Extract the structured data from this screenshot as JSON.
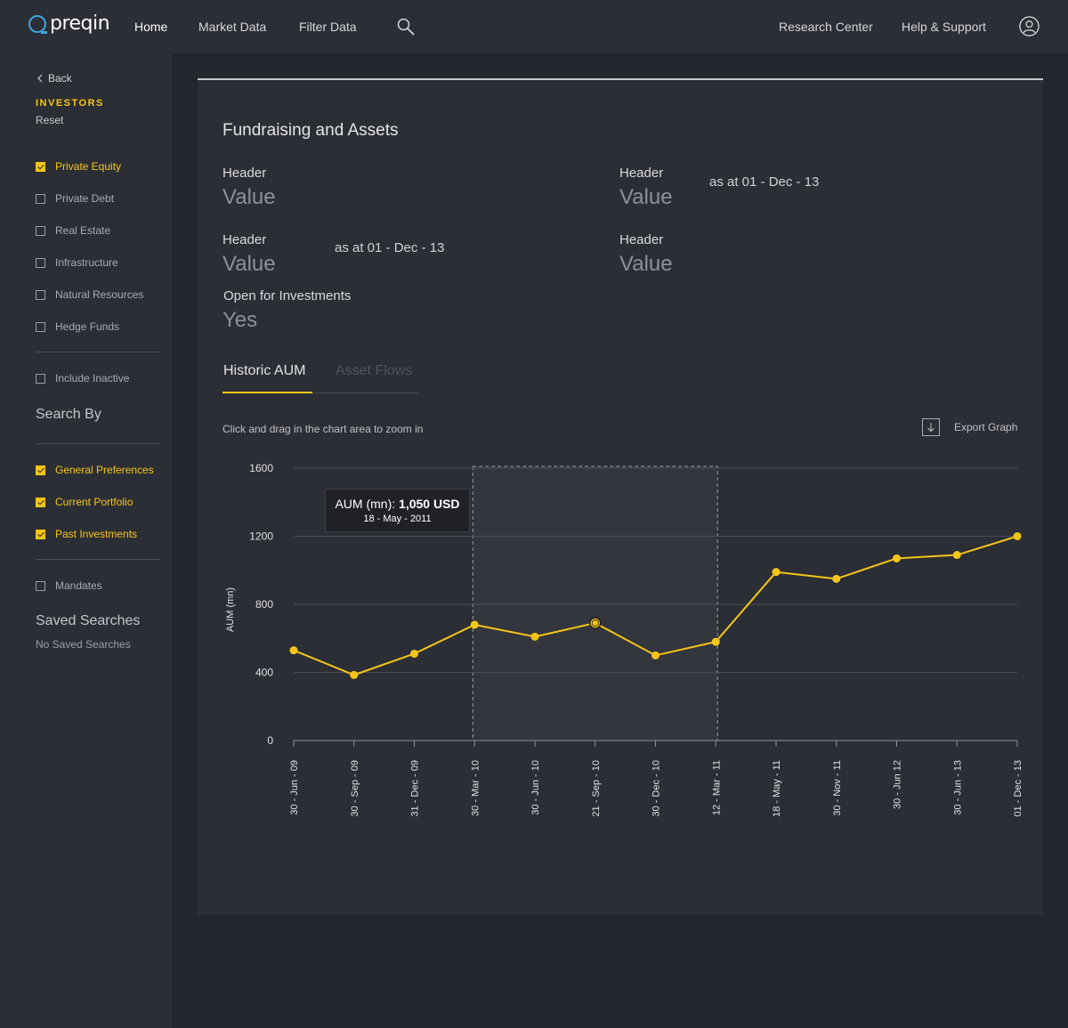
{
  "brand": {
    "name": "preqin",
    "accent": "#3aa7e0"
  },
  "nav": {
    "home": "Home",
    "market_data": "Market Data",
    "filter_data": "Filter Data",
    "research_center": "Research Center",
    "help_support": "Help & Support"
  },
  "sidebar": {
    "back": "Back",
    "section": "INVESTORS",
    "reset": "Reset",
    "asset_classes": [
      {
        "label": "Private Equity",
        "checked": true
      },
      {
        "label": "Private Debt",
        "checked": false
      },
      {
        "label": "Real Estate",
        "checked": false
      },
      {
        "label": "Infrastructure",
        "checked": false
      },
      {
        "label": "Natural Resources",
        "checked": false
      },
      {
        "label": "Hedge Funds",
        "checked": false
      }
    ],
    "include_inactive": {
      "label": "Include Inactive",
      "checked": false
    },
    "search_by_heading": "Search By",
    "search_by": [
      {
        "label": "General Preferences",
        "checked": true
      },
      {
        "label": "Current Portfolio",
        "checked": true
      },
      {
        "label": "Past Investments",
        "checked": true
      }
    ],
    "mandates": {
      "label": "Mandates",
      "checked": false
    },
    "saved_searches_heading": "Saved Searches",
    "saved_searches_empty": "No Saved Searches"
  },
  "main": {
    "title": "Fundraising and Assets",
    "fields": [
      {
        "header": "Header",
        "value": "Value",
        "note": ""
      },
      {
        "header": "Header",
        "value": "Value",
        "note": "as at 01 - Dec - 13"
      },
      {
        "header": "Header",
        "value": "Value",
        "note": "as at 01 - Dec - 13"
      },
      {
        "header": "Header",
        "value": "Value",
        "note": ""
      }
    ],
    "open_for_investments": {
      "header": "Open for Investments",
      "value": "Yes"
    },
    "tabs": [
      {
        "label": "Historic AUM",
        "active": true
      },
      {
        "label": "Asset Flows",
        "active": false
      }
    ],
    "hint": "Click and drag in the chart area to zoom in",
    "export_label": "Export Graph",
    "tooltip": {
      "prefix": "AUM (mn):",
      "value": "1,050 USD",
      "date": "18 - May - 2011"
    }
  },
  "colors": {
    "accent": "#f5c518",
    "background": "#23262d",
    "panel": "#2b2e35"
  },
  "chart_data": {
    "type": "line",
    "ylabel": "AUM (mn)",
    "xlabel": "",
    "ylim": [
      0,
      1600
    ],
    "yticks": [
      0,
      400,
      800,
      1200,
      1600
    ],
    "grid": true,
    "categories": [
      "30 - Jun - 09",
      "30 - Sep - 09",
      "31 - Dec - 09",
      "30 - Mar - 10",
      "30 - Jun - 10",
      "21 - Sep - 10",
      "30 - Dec - 10",
      "12 - Mar - 11",
      "18 - May - 11",
      "30 - Nov - 11",
      "30 - Jun 12",
      "30 - Jun - 13",
      "01 - Dec - 13"
    ],
    "series": [
      {
        "values": [
          530,
          385,
          510,
          680,
          610,
          690,
          500,
          580,
          990,
          950,
          1070,
          1090,
          1200
        ],
        "color": "#f5c518"
      }
    ],
    "highlighted_index": 5,
    "zoom_selection": {
      "from_index": 3,
      "to_index": 7
    }
  }
}
